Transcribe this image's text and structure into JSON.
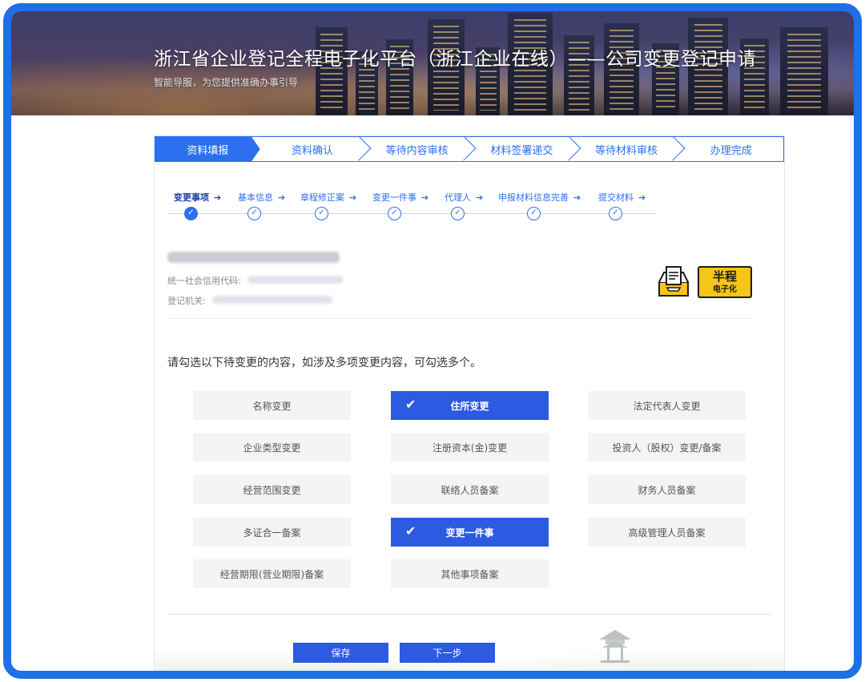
{
  "banner": {
    "title": "浙江省企业登记全程电子化平台（浙江企业在线）——公司变更登记申请",
    "subtitle": "智能导服，为您提供准确办事引导"
  },
  "steps": [
    {
      "label": "资料填报",
      "active": true
    },
    {
      "label": "资料确认",
      "active": false
    },
    {
      "label": "等待内容审核",
      "active": false
    },
    {
      "label": "材料签署递交",
      "active": false
    },
    {
      "label": "等待材料审核",
      "active": false
    },
    {
      "label": "办理完成",
      "active": false
    }
  ],
  "substeps": [
    {
      "label": "变更事项",
      "current": true
    },
    {
      "label": "基本信息",
      "current": false
    },
    {
      "label": "章程修正案",
      "current": false
    },
    {
      "label": "变更一件事",
      "current": false
    },
    {
      "label": "代理人",
      "current": false
    },
    {
      "label": "申报材料信息完善",
      "current": false
    },
    {
      "label": "提交材料",
      "current": false
    }
  ],
  "company": {
    "credit_code_label": "统一社会信用代码:",
    "registry_label": "登记机关:"
  },
  "badge": {
    "big": "半程",
    "small": "电子化",
    "icon": "document-tray-icon"
  },
  "instruction": "请勾选以下待变更的内容，如涉及多项变更内容，可勾选多个。",
  "options": [
    {
      "label": "名称变更",
      "selected": false
    },
    {
      "label": "住所变更",
      "selected": true
    },
    {
      "label": "法定代表人变更",
      "selected": false
    },
    {
      "label": "企业类型变更",
      "selected": false
    },
    {
      "label": "注册资本(金)变更",
      "selected": false
    },
    {
      "label": "投资人（股权）变更/备案",
      "selected": false
    },
    {
      "label": "经营范围变更",
      "selected": false
    },
    {
      "label": "联络人员备案",
      "selected": false
    },
    {
      "label": "财务人员备案",
      "selected": false
    },
    {
      "label": "多证合一备案",
      "selected": false
    },
    {
      "label": "变更一件事",
      "selected": true
    },
    {
      "label": "高级管理人员备案",
      "selected": false
    },
    {
      "label": "经营期限(营业期限)备案",
      "selected": false
    },
    {
      "label": "其他事项备案",
      "selected": false
    }
  ],
  "buttons": {
    "save": "保存",
    "next": "下一步"
  },
  "colors": {
    "accent": "#2c6ff0",
    "selected": "#2c5ae0",
    "frame": "#1f6fe6",
    "badge": "#f5c518"
  }
}
